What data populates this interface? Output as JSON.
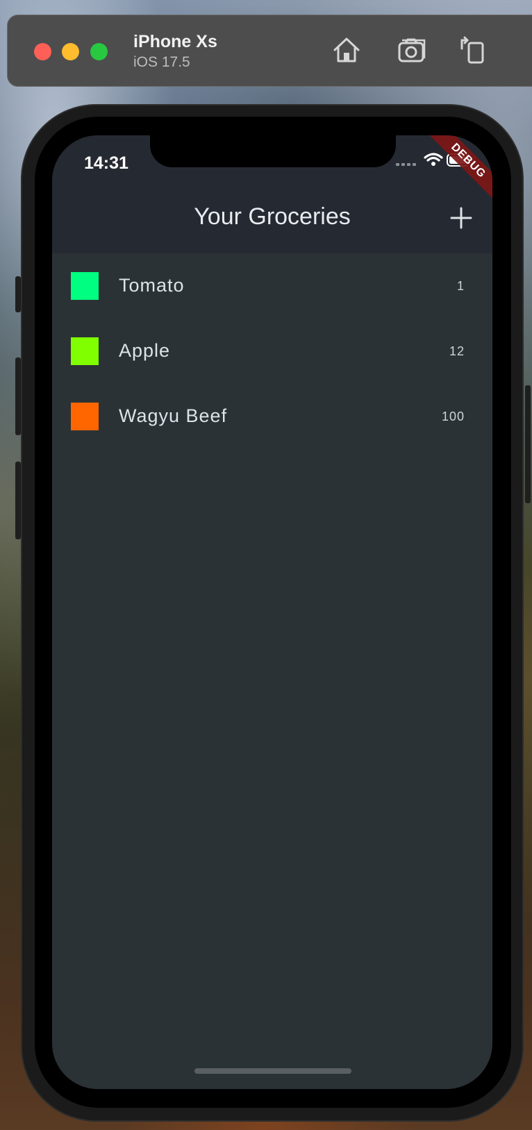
{
  "simulator": {
    "device_name": "iPhone Xs",
    "os_version": "iOS 17.5",
    "icons": [
      "home-icon",
      "screenshot-icon",
      "rotate-icon"
    ]
  },
  "status_bar": {
    "time": "14:31",
    "icons": [
      "cellular-icon",
      "wifi-icon",
      "battery-icon"
    ]
  },
  "debug_banner": "DEBUG",
  "appbar": {
    "title": "Your Groceries",
    "action_icon": "add-icon"
  },
  "groceries": [
    {
      "name": "Tomato",
      "quantity": "1",
      "color": "#00ff80"
    },
    {
      "name": "Apple",
      "quantity": "12",
      "color": "#80ff00"
    },
    {
      "name": "Wagyu Beef",
      "quantity": "100",
      "color": "#ff6600"
    }
  ]
}
